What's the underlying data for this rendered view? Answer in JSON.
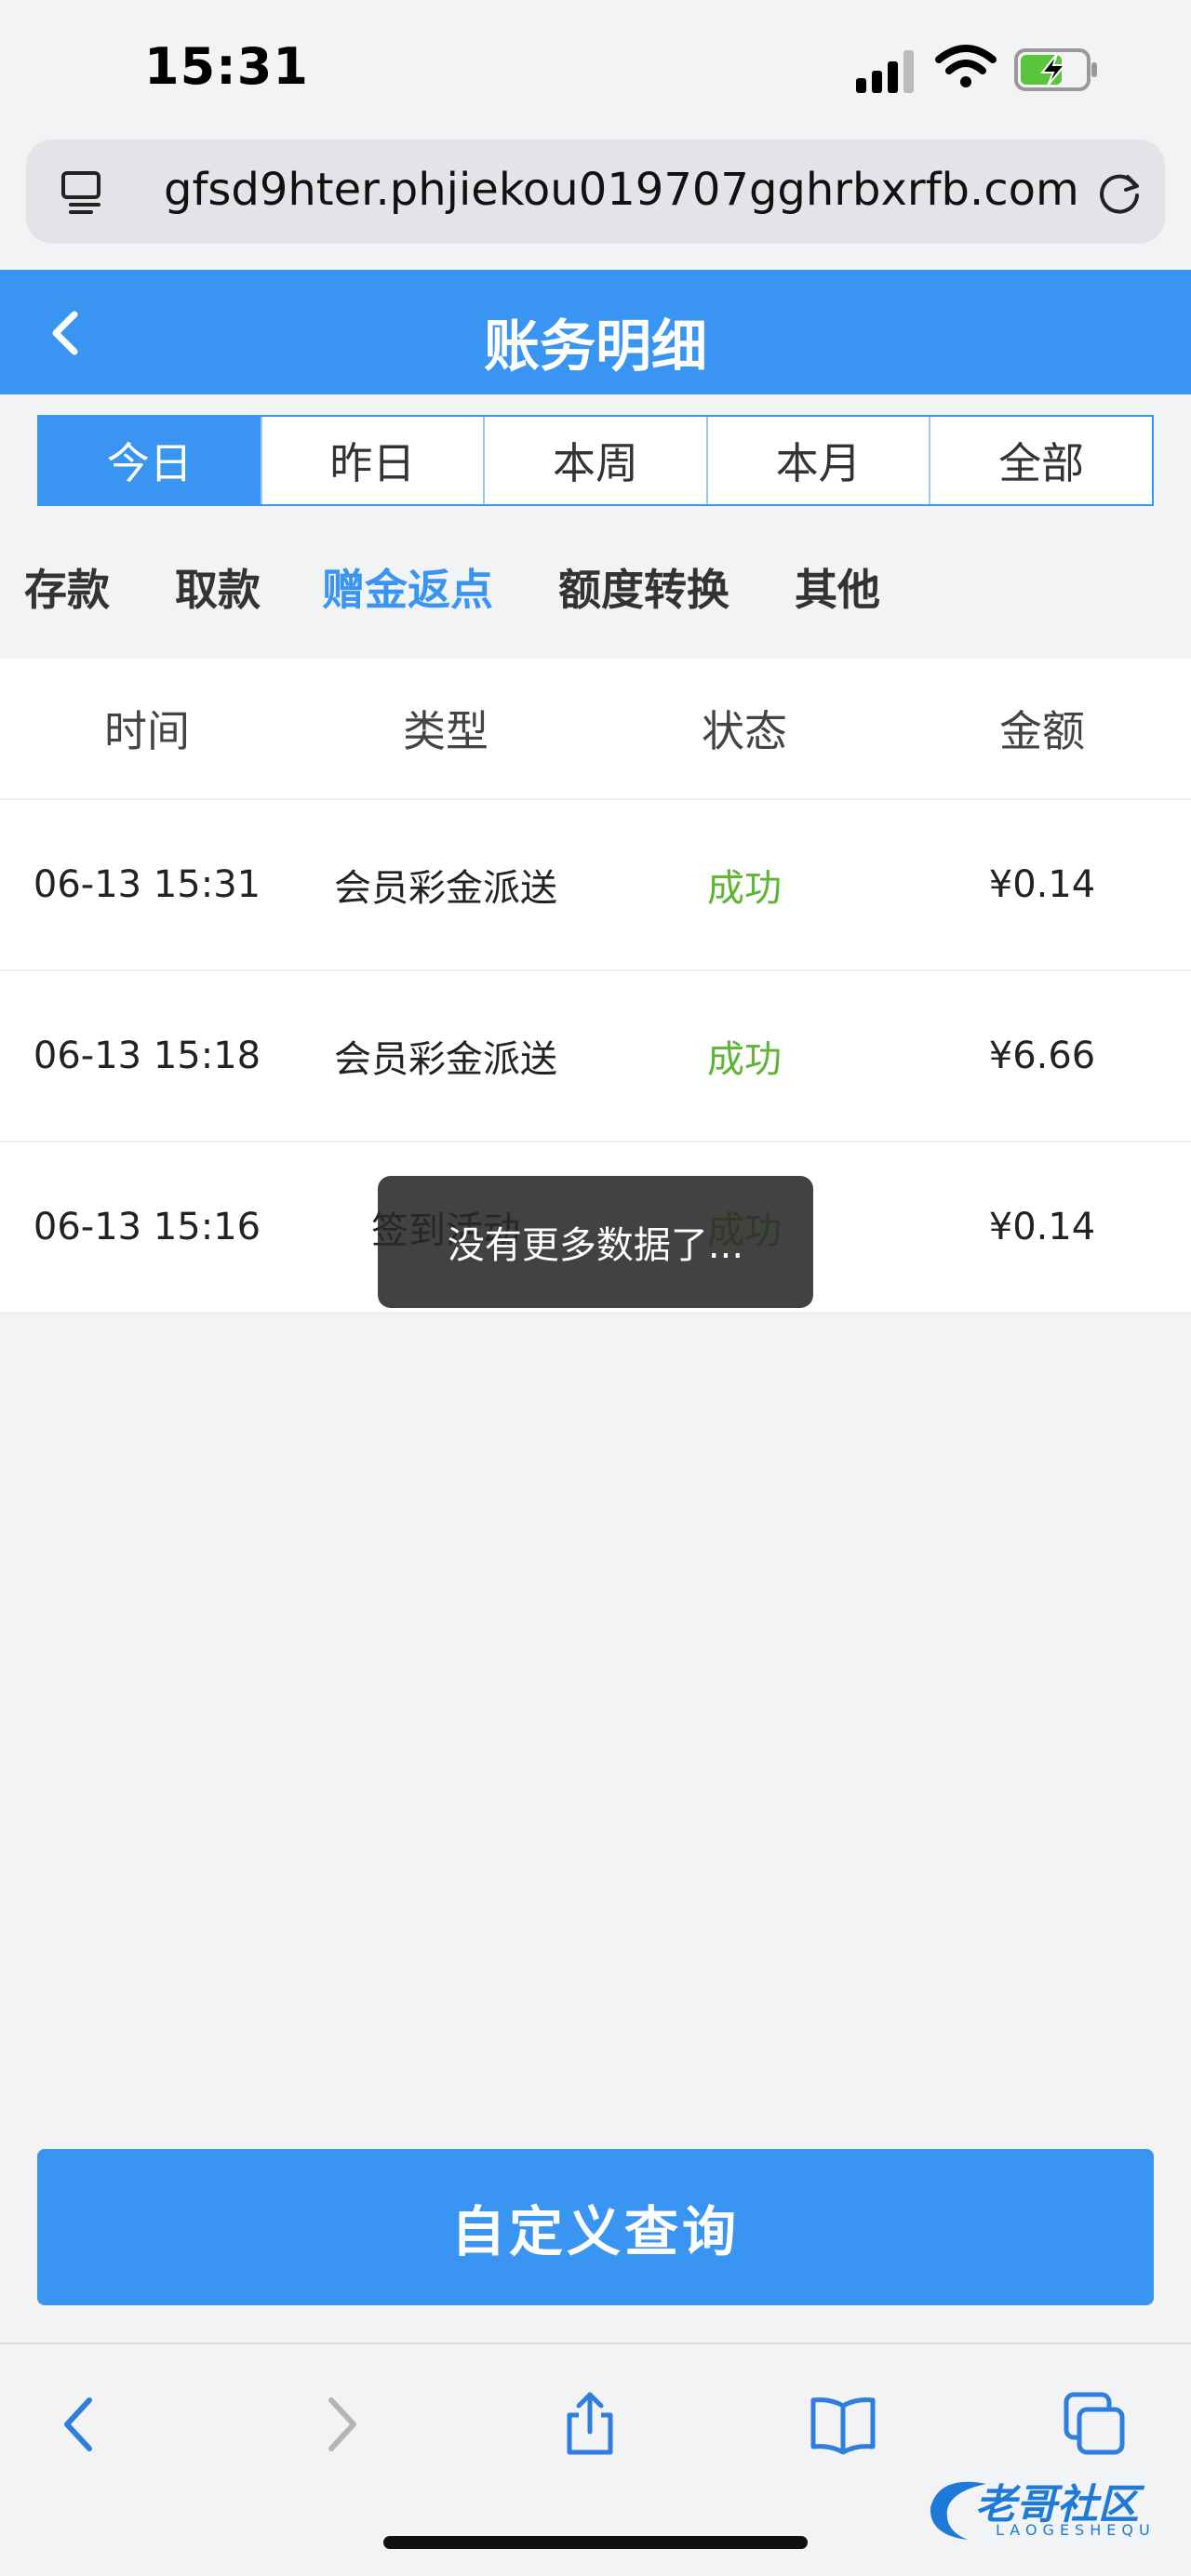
{
  "status_bar": {
    "time": "15:31"
  },
  "browser": {
    "url": "gfsd9hter.phjiekou019707gghrbxrfb.com"
  },
  "header": {
    "title": "账务明细"
  },
  "period_tabs": [
    "今日",
    "昨日",
    "本周",
    "本月",
    "全部"
  ],
  "category_tabs": [
    "存款",
    "取款",
    "赠金返点",
    "额度转换",
    "其他"
  ],
  "active_category": "赠金返点",
  "table": {
    "columns": [
      "时间",
      "类型",
      "状态",
      "金额"
    ],
    "rows": [
      {
        "time": "06-13 15:31",
        "type": "会员彩金派送",
        "status": "成功",
        "amount": "¥0.14"
      },
      {
        "time": "06-13 15:18",
        "type": "会员彩金派送",
        "status": "成功",
        "amount": "¥6.66"
      },
      {
        "time": "06-13 15:16",
        "type": "签到活动",
        "status": "成功",
        "amount": "¥0.14"
      }
    ]
  },
  "toast": "没有更多数据了...",
  "custom_query_label": "自定义查询",
  "watermark": {
    "text": "老哥社区",
    "sub": "LAOGESHEQU"
  },
  "colors": {
    "primary": "#3a95f2",
    "success": "#5db533",
    "background": "#f2f3f5"
  }
}
